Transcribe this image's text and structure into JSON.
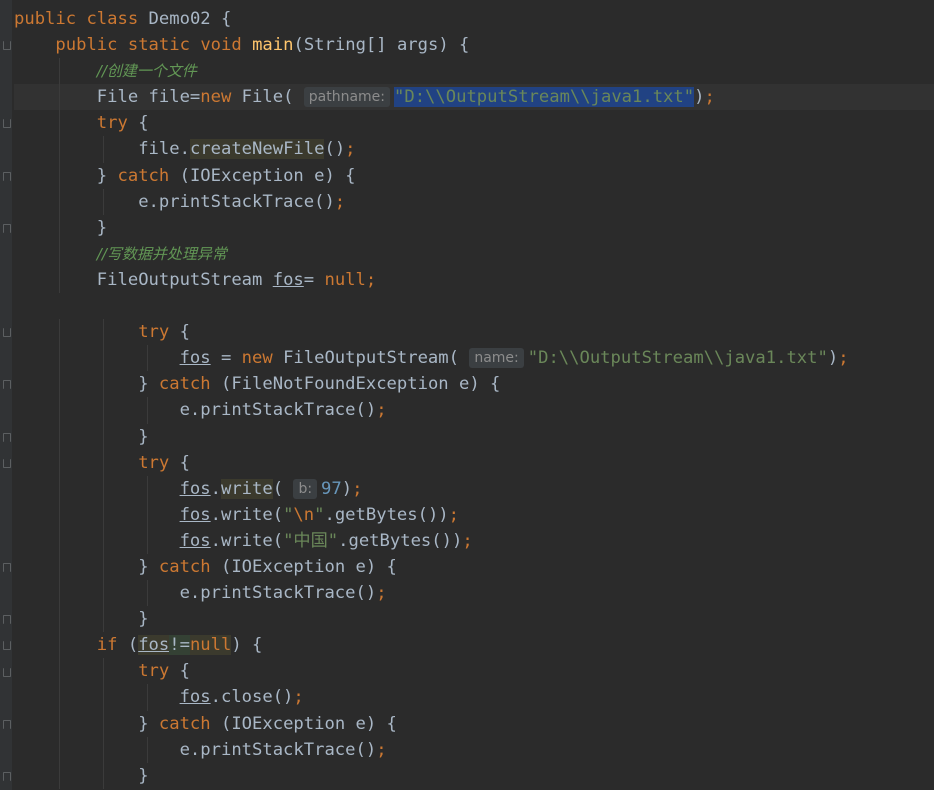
{
  "editor": {
    "lines": [
      {
        "indent": 0,
        "tokens": [
          [
            "kw",
            "public"
          ],
          [
            "plain",
            " "
          ],
          [
            "kw",
            "class"
          ],
          [
            "plain",
            " Demo02 {"
          ]
        ]
      },
      {
        "indent": 1,
        "tokens": [
          [
            "kw",
            "public"
          ],
          [
            "plain",
            " "
          ],
          [
            "kw",
            "static"
          ],
          [
            "plain",
            " "
          ],
          [
            "kw",
            "void"
          ],
          [
            "plain",
            " "
          ],
          [
            "fn",
            "main"
          ],
          [
            "plain",
            "(String[] args) {"
          ]
        ]
      },
      {
        "indent": 2,
        "tokens": [
          [
            "cmt",
            "//创建一个文件"
          ]
        ]
      },
      {
        "indent": 2,
        "caret": true,
        "tokens": [
          [
            "plain",
            "File file="
          ],
          [
            "kw",
            "new"
          ],
          [
            "plain",
            " File( "
          ],
          [
            "hint",
            "pathname:"
          ],
          [
            "sel",
            "\"D:\\\\OutputStream\\\\java1.txt\""
          ],
          [
            "plain",
            ")"
          ],
          [
            "kw",
            ";"
          ]
        ]
      },
      {
        "indent": 2,
        "tokens": [
          [
            "kw",
            "try"
          ],
          [
            "plain",
            " {"
          ]
        ]
      },
      {
        "indent": 3,
        "tokens": [
          [
            "plain",
            "file."
          ],
          [
            "hl",
            "createNewFile"
          ],
          [
            "plain",
            "()"
          ],
          [
            "kw",
            ";"
          ]
        ]
      },
      {
        "indent": 2,
        "tokens": [
          [
            "plain",
            "} "
          ],
          [
            "kw",
            "catch"
          ],
          [
            "plain",
            " (IOException e) {"
          ]
        ]
      },
      {
        "indent": 3,
        "tokens": [
          [
            "plain",
            "e.printStackTrace()"
          ],
          [
            "kw",
            ";"
          ]
        ]
      },
      {
        "indent": 2,
        "tokens": [
          [
            "plain",
            "}"
          ]
        ]
      },
      {
        "indent": 2,
        "tokens": [
          [
            "cmt",
            "//写数据并处理异常"
          ]
        ]
      },
      {
        "indent": 2,
        "tokens": [
          [
            "plain",
            "FileOutputStream "
          ],
          [
            "var",
            "fos"
          ],
          [
            "plain",
            "= "
          ],
          [
            "kw",
            "null;"
          ]
        ]
      },
      {
        "indent": 0,
        "tokens": []
      },
      {
        "indent": 3,
        "tokens": [
          [
            "kw",
            "try"
          ],
          [
            "plain",
            " {"
          ]
        ]
      },
      {
        "indent": 4,
        "tokens": [
          [
            "var",
            "fos"
          ],
          [
            "plain",
            " = "
          ],
          [
            "kw",
            "new"
          ],
          [
            "plain",
            " FileOutputStream( "
          ],
          [
            "hint",
            "name:"
          ],
          [
            "str",
            "\"D:\\\\OutputStream\\\\java1.txt\""
          ],
          [
            "plain",
            ")"
          ],
          [
            "kw",
            ";"
          ]
        ]
      },
      {
        "indent": 3,
        "tokens": [
          [
            "plain",
            "} "
          ],
          [
            "kw",
            "catch"
          ],
          [
            "plain",
            " (FileNotFoundException e) {"
          ]
        ]
      },
      {
        "indent": 4,
        "tokens": [
          [
            "plain",
            "e.printStackTrace()"
          ],
          [
            "kw",
            ";"
          ]
        ]
      },
      {
        "indent": 3,
        "tokens": [
          [
            "plain",
            "}"
          ]
        ]
      },
      {
        "indent": 3,
        "tokens": [
          [
            "kw",
            "try"
          ],
          [
            "plain",
            " {"
          ]
        ]
      },
      {
        "indent": 4,
        "tokens": [
          [
            "var",
            "fos"
          ],
          [
            "plain",
            "."
          ],
          [
            "hl",
            "write"
          ],
          [
            "plain",
            "( "
          ],
          [
            "hint",
            "b:"
          ],
          [
            "num",
            "97"
          ],
          [
            "plain",
            ")"
          ],
          [
            "kw",
            ";"
          ]
        ]
      },
      {
        "indent": 4,
        "tokens": [
          [
            "var",
            "fos"
          ],
          [
            "plain",
            ".write("
          ],
          [
            "str",
            "\""
          ],
          [
            "esc",
            "\\n"
          ],
          [
            "str",
            "\""
          ],
          [
            "plain",
            ".getBytes())"
          ],
          [
            "kw",
            ";"
          ]
        ]
      },
      {
        "indent": 4,
        "tokens": [
          [
            "var",
            "fos"
          ],
          [
            "plain",
            ".write("
          ],
          [
            "str",
            "\"中国\""
          ],
          [
            "plain",
            ".getBytes())"
          ],
          [
            "kw",
            ";"
          ]
        ]
      },
      {
        "indent": 3,
        "tokens": [
          [
            "plain",
            "} "
          ],
          [
            "kw",
            "catch"
          ],
          [
            "plain",
            " (IOException e) {"
          ]
        ]
      },
      {
        "indent": 4,
        "tokens": [
          [
            "plain",
            "e.printStackTrace()"
          ],
          [
            "kw",
            ";"
          ]
        ]
      },
      {
        "indent": 3,
        "tokens": [
          [
            "plain",
            "}"
          ]
        ]
      },
      {
        "indent": 2,
        "tokens": [
          [
            "kw",
            "if"
          ],
          [
            "plain",
            " ("
          ],
          [
            "hlvar",
            "fos"
          ],
          [
            "hlt",
            "!="
          ],
          [
            "hlkw",
            "null"
          ],
          [
            "plain",
            ") {"
          ]
        ]
      },
      {
        "indent": 3,
        "tokens": [
          [
            "kw",
            "try"
          ],
          [
            "plain",
            " {"
          ]
        ]
      },
      {
        "indent": 4,
        "tokens": [
          [
            "var",
            "fos"
          ],
          [
            "plain",
            ".close()"
          ],
          [
            "kw",
            ";"
          ]
        ]
      },
      {
        "indent": 3,
        "tokens": [
          [
            "plain",
            "} "
          ],
          [
            "kw",
            "catch"
          ],
          [
            "plain",
            " (IOException e) {"
          ]
        ]
      },
      {
        "indent": 4,
        "tokens": [
          [
            "plain",
            "e.printStackTrace()"
          ],
          [
            "kw",
            ";"
          ]
        ]
      },
      {
        "indent": 3,
        "tokens": [
          [
            "plain",
            "}"
          ]
        ]
      }
    ]
  }
}
